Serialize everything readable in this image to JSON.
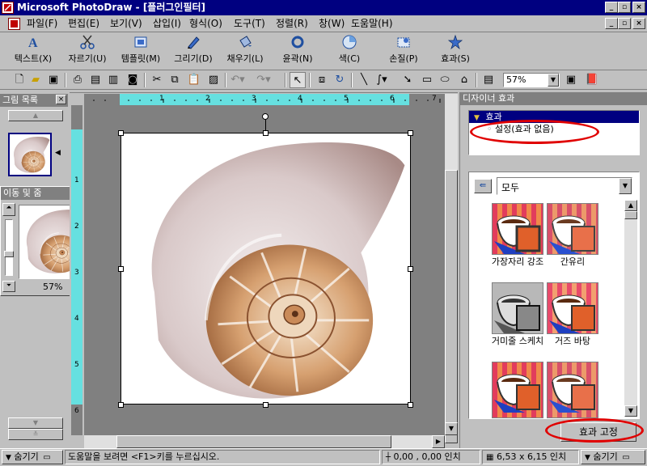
{
  "window": {
    "title": "Microsoft PhotoDraw - [플러그인필터]",
    "controls": [
      "_",
      "▫",
      "×"
    ]
  },
  "menu": {
    "items": [
      "파일(F)",
      "편집(E)",
      "보기(V)",
      "삽입(I)",
      "형식(O)",
      "도구(T)",
      "정렬(R)",
      "창(W)",
      "도움말(H)"
    ],
    "controls": [
      "_",
      "▫",
      "×"
    ]
  },
  "big_toolbar": {
    "items": [
      {
        "label": "텍스트(X)",
        "icon": "text-icon"
      },
      {
        "label": "자르기(U)",
        "icon": "scissors-icon"
      },
      {
        "label": "템플릿(M)",
        "icon": "template-icon"
      },
      {
        "label": "그리기(D)",
        "icon": "pen-icon"
      },
      {
        "label": "채우기(L)",
        "icon": "bucket-icon"
      },
      {
        "label": "윤곽(N)",
        "icon": "outline-icon"
      },
      {
        "label": "색(C)",
        "icon": "color-icon"
      },
      {
        "label": "손질(P)",
        "icon": "touchup-icon"
      },
      {
        "label": "효과(S)",
        "icon": "effects-icon"
      }
    ]
  },
  "std_toolbar": {
    "zoom": "57%"
  },
  "gallery": {
    "title": "그림 목록"
  },
  "pan_zoom": {
    "title": "이동 및 줌",
    "zoom": "57%"
  },
  "ruler": {
    "labels": [
      "1",
      "2",
      "3",
      "4",
      "5",
      "6",
      "7"
    ],
    "vlabels": [
      "1",
      "2",
      "3",
      "4",
      "5",
      "6"
    ]
  },
  "designer": {
    "title": "디자이너 효과",
    "tree_header": "효과",
    "tree_item": "설정(효과 없음)",
    "category": "모두",
    "effects": [
      {
        "label": "가장자리 강조"
      },
      {
        "label": "간유리"
      },
      {
        "label": "거미줄 스케치"
      },
      {
        "label": "거즈 바탕"
      },
      {
        "label": ""
      },
      {
        "label": ""
      }
    ],
    "apply_button": "효과 고정"
  },
  "status": {
    "hide_left": "숨기기",
    "help": "도움말을 보려면 <F1>키를 누르십시오.",
    "coords": "0,00 , 0,00 인치",
    "size": "6,53 x 6,15 인치",
    "hide_right": "숨기기"
  },
  "colors": {
    "title_bar": "#000080",
    "canvas_bg": "#808080",
    "ruler_active": "#66e0e0",
    "highlight_red": "#e00000"
  }
}
